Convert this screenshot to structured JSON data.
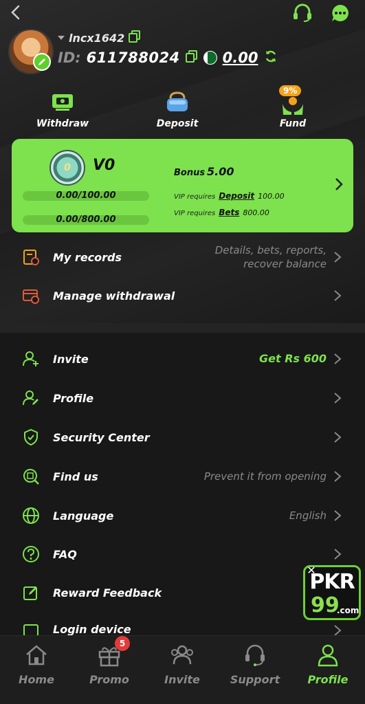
{
  "header": {
    "username": "lncx1642",
    "id_label": "ID:",
    "id_value": "611788024",
    "balance": "0.00"
  },
  "quick_actions": [
    {
      "label": "Withdraw",
      "icon": "withdraw-icon"
    },
    {
      "label": "Deposit",
      "icon": "wallet-icon"
    },
    {
      "label": "Fund",
      "icon": "fund-hands-icon",
      "badge": "9%"
    }
  ],
  "vip": {
    "badge_text": "0",
    "level": "V0",
    "deposit_progress": "0.00/100.00",
    "bets_progress": "0.00/800.00",
    "deposit_fraction": 0,
    "bets_fraction": 0,
    "bonus_label": "Bonus",
    "bonus_value": "5.00",
    "req_deposit_prefix": "VIP requires",
    "req_deposit_link": "Deposit",
    "req_deposit_amount": "100.00",
    "req_bets_prefix": "VIP requires",
    "req_bets_link": "Bets",
    "req_bets_amount": "800.00"
  },
  "menu_top": [
    {
      "label": "My records",
      "hint_line1": "Details, bets, reports,",
      "hint_line2": "recover balance",
      "icon": "records-icon"
    },
    {
      "label": "Manage withdrawal",
      "hint_line1": "",
      "hint_line2": "",
      "icon": "card-settings-icon"
    }
  ],
  "menu_main": [
    {
      "label": "Invite",
      "hint": "Get Rs 600",
      "icon": "invite-user-icon"
    },
    {
      "label": "Profile",
      "hint": "",
      "icon": "profile-edit-icon"
    },
    {
      "label": "Security Center",
      "hint": "",
      "icon": "shield-check-icon"
    },
    {
      "label": "Find us",
      "hint": "Prevent it from opening",
      "icon": "find-us-icon"
    },
    {
      "label": "Language",
      "hint": "English",
      "icon": "globe-icon"
    },
    {
      "label": "FAQ",
      "hint": "",
      "icon": "question-icon"
    },
    {
      "label": "Reward Feedback",
      "hint": "",
      "icon": "feedback-edit-icon"
    },
    {
      "label": "Login device",
      "hint": "",
      "icon": "device-icon"
    }
  ],
  "floating_ad": {
    "top": "PKR",
    "bottom": "99",
    "suffix": ".com"
  },
  "bottom_nav": [
    {
      "label": "Home",
      "icon": "home-icon"
    },
    {
      "label": "Promo",
      "icon": "gift-icon",
      "badge": "5"
    },
    {
      "label": "Invite",
      "icon": "invite-people-icon"
    },
    {
      "label": "Support",
      "icon": "headset-icon"
    },
    {
      "label": "Profile",
      "icon": "profile-icon",
      "active": true
    }
  ],
  "colors": {
    "accent": "#7de24d",
    "background": "#181818"
  }
}
